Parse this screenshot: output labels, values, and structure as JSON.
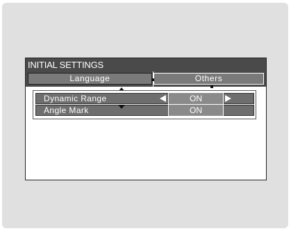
{
  "window": {
    "title": "INITIAL SETTINGS"
  },
  "tabs": [
    {
      "label": "Language",
      "selected": false
    },
    {
      "label": "Others",
      "selected": true
    }
  ],
  "settings": [
    {
      "label": "Dynamic Range",
      "value": "ON",
      "active": true
    },
    {
      "label": "Angle Mark",
      "value": "ON",
      "active": false
    }
  ],
  "icons": {
    "left_arrow": "left-arrow-icon",
    "right_arrow": "right-arrow-icon",
    "scroll_up": "scroll-up-icon",
    "scroll_down": "scroll-down-icon"
  },
  "colors": {
    "background": "#e0e0e0",
    "title_bar": "#4a4a4a",
    "row": "#6e6e6e"
  }
}
